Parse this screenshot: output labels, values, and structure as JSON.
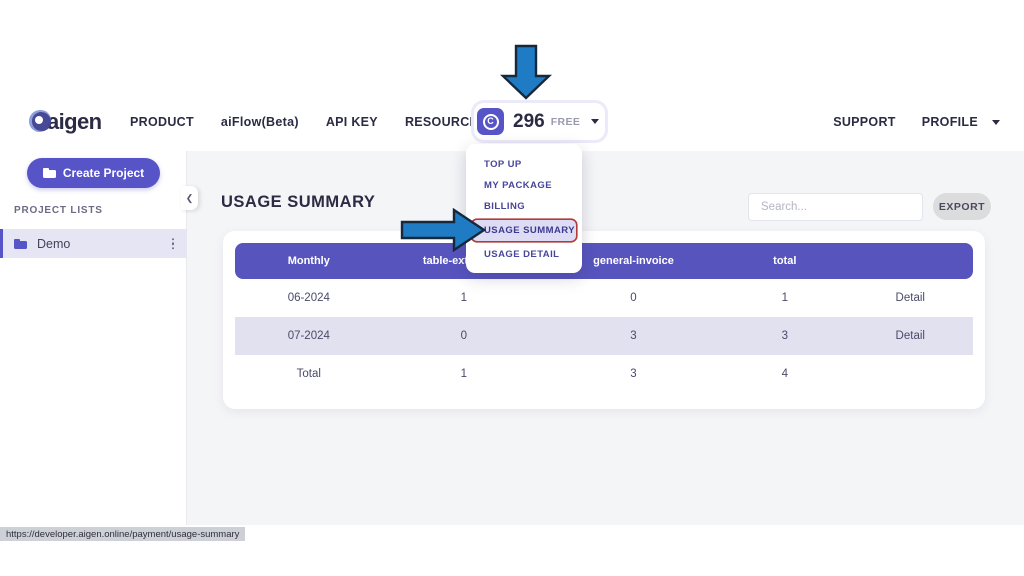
{
  "brand": {
    "logo_text": "aigen",
    "accent_color": "#5754c7",
    "table_header_color": "#5754be"
  },
  "topnav": {
    "links": [
      {
        "label": "PRODUCT"
      },
      {
        "label": "aiFlow(Beta)"
      },
      {
        "label": "API KEY"
      },
      {
        "label": "RESOURCES"
      }
    ],
    "credit": {
      "coin_icon": "coin-c-icon",
      "coin_letter": "C",
      "amount": "296",
      "plan": "FREE",
      "caret_icon": "chevron-down-icon"
    },
    "right_links": [
      {
        "label": "SUPPORT"
      },
      {
        "label": "PROFILE"
      }
    ],
    "profile_caret_icon": "chevron-down-icon"
  },
  "dropdown": {
    "items": [
      {
        "label": "TOP UP",
        "highlighted": false
      },
      {
        "label": "MY PACKAGE",
        "highlighted": false
      },
      {
        "label": "BILLING",
        "highlighted": false
      },
      {
        "label": "USAGE SUMMARY",
        "highlighted": true
      },
      {
        "label": "USAGE DETAIL",
        "highlighted": false
      }
    ],
    "highlight_border_color": "#b23a3a",
    "highlight_bg_color": "#dedcf4"
  },
  "sidebar": {
    "create_button": {
      "label": "Create Project",
      "icon": "folder-plus-icon"
    },
    "section_label": "PROJECT LISTS",
    "projects": [
      {
        "label": "Demo",
        "icon": "folder-icon",
        "menu_icon": "kebab-menu-icon",
        "selected": true
      }
    ],
    "collapse_icon": "chevron-left-icon"
  },
  "main": {
    "page_title": "USAGE SUMMARY",
    "search": {
      "placeholder": "Search...",
      "value": "",
      "icon": "search-icon"
    },
    "export_button": {
      "label": "EXPORT"
    }
  },
  "table": {
    "columns": [
      "Monthly",
      "table-extraction",
      "general-invoice",
      "total",
      ""
    ],
    "rows": [
      {
        "cells": [
          "06-2024",
          "1",
          "0",
          "1"
        ],
        "action": "Detail",
        "alt": false
      },
      {
        "cells": [
          "07-2024",
          "0",
          "3",
          "3"
        ],
        "action": "Detail",
        "alt": true
      },
      {
        "cells": [
          "Total",
          "1",
          "3",
          "4"
        ],
        "action": "",
        "alt": false
      }
    ]
  },
  "annotations": {
    "arrow_down": {
      "name": "annotation-arrow-down",
      "color": "#1f7cc4",
      "target": "credit-pill"
    },
    "arrow_right": {
      "name": "annotation-arrow-right",
      "color": "#1f7cc4",
      "target": "dropdown-item-usage-summary"
    }
  },
  "statusbar": {
    "url": "https://developer.aigen.online/payment/usage-summary"
  }
}
